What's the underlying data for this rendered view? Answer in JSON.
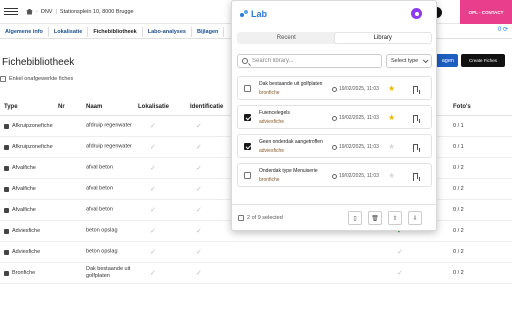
{
  "header": {
    "org": "DNV",
    "address": "Stationsplein 10, 8000 Brugge",
    "opl_label": "OPL - CONTACT"
  },
  "tabs": [
    "Algemene info",
    "Lokalisatie",
    "Fichebibliotheek",
    "Labo-analyses",
    "Bijlagen"
  ],
  "tab_counter": "0 ⟳",
  "page": {
    "title": "Fichebibliotheek",
    "only_label": "Enkel onafgewerkte fiches",
    "btn_primary": "agen",
    "btn_create": "Create Fiches"
  },
  "table": {
    "headers": [
      "Type",
      "Nr",
      "Naam",
      "Lokalisatie",
      "Identificatie",
      "Foto's"
    ],
    "rows": [
      {
        "type": "Afkruipzonefiche",
        "naam": "afdruip regenwater",
        "fotos": "0 / 1",
        "green": false
      },
      {
        "type": "Afkruipzonefiche",
        "naam": "afdruip regenwater",
        "fotos": "0 / 1",
        "green": false
      },
      {
        "type": "Afvalfiche",
        "naam": "afval beton",
        "fotos": "0 / 2",
        "green": false
      },
      {
        "type": "Afvalfiche",
        "naam": "afval beton",
        "fotos": "0 / 2",
        "green": false
      },
      {
        "type": "Afvalfiche",
        "naam": "afval beton",
        "fotos": "0 / 2",
        "green": true
      },
      {
        "type": "Adviesfiche",
        "naam": "beton opslag",
        "fotos": "0 / 2",
        "green": true
      },
      {
        "type": "Adviesfiche",
        "naam": "beton opslag",
        "fotos": "0 / 2",
        "green": false
      },
      {
        "type": "Bronfiche",
        "naam": "Dak bestaande uit golfplaten",
        "fotos": "0 / 2",
        "green": false
      }
    ]
  },
  "popup": {
    "logo": "Lab",
    "tabs": {
      "recent": "Recent",
      "library": "Library"
    },
    "search_placeholder": "Search library...",
    "select_type": "Select type",
    "items": [
      {
        "title": "Dak bestaande uit golfplaten",
        "type": "bronfiche",
        "date": "19/02/2025, 11:03",
        "checked": false,
        "starred": true
      },
      {
        "title": "Fuiencelegels",
        "type": "adviesfiche",
        "date": "19/02/2025, 11:03",
        "checked": true,
        "starred": true
      },
      {
        "title": "Geen onderdak aangetroffen",
        "type": "adviesfiche",
        "date": "19/02/2025, 11:03",
        "checked": true,
        "starred": false
      },
      {
        "title": "Onderdak type Menuiserie",
        "type": "bronfiche",
        "date": "19/02/2025, 11:03",
        "checked": false,
        "starred": false
      }
    ],
    "selected_text": "2 of 9 selected"
  },
  "colors": {
    "accent": "#2a7ad5",
    "pink": "#e83e8c",
    "star": "#f0b400",
    "check_green": "#22a33a"
  }
}
